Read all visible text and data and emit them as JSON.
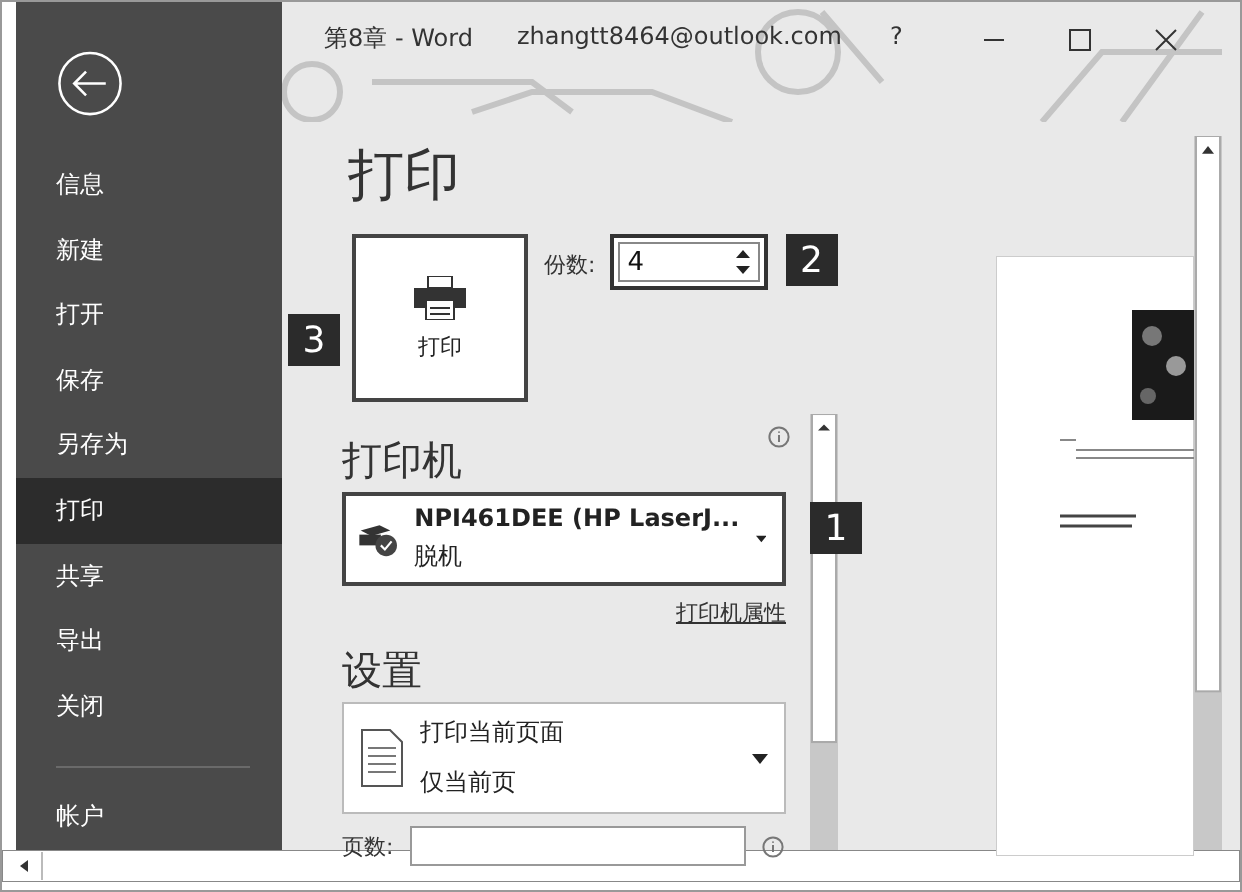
{
  "window": {
    "title": "第8章 - Word",
    "account": "zhangtt8464@outlook.com",
    "help": "?"
  },
  "sidebar": {
    "items": [
      {
        "label": "信息",
        "selected": false
      },
      {
        "label": "新建",
        "selected": false
      },
      {
        "label": "打开",
        "selected": false
      },
      {
        "label": "保存",
        "selected": false
      },
      {
        "label": "另存为",
        "selected": false
      },
      {
        "label": "打印",
        "selected": true
      },
      {
        "label": "共享",
        "selected": false
      },
      {
        "label": "导出",
        "selected": false
      },
      {
        "label": "关闭",
        "selected": false
      }
    ],
    "footer": "帐户"
  },
  "print": {
    "heading": "打印",
    "button": "打印",
    "copies_label": "份数:",
    "copies_value": "4"
  },
  "callouts": [
    "3",
    "2",
    "1"
  ],
  "printer": {
    "heading": "打印机",
    "name": "NPI461DEE (HP LaserJ...",
    "status": "脱机",
    "properties_link": "打印机属性"
  },
  "settings": {
    "heading": "设置",
    "option_title": "打印当前页面",
    "option_subtitle": "仅当前页",
    "pages_label": "页数:"
  }
}
